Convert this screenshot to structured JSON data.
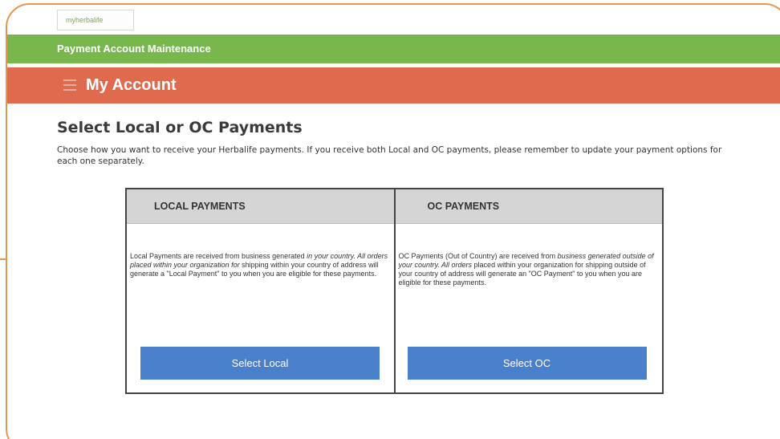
{
  "logo": {
    "text": "myherbalife"
  },
  "green_bar": {
    "title": "Payment Account Maintenance"
  },
  "red_bar": {
    "title": "My Account"
  },
  "main": {
    "title": "Select Local or OC Payments",
    "intro": "Choose how you want to receive your Herbalife payments. If you receive both Local and OC payments, please remember to update your payment options for each one separately."
  },
  "local": {
    "header": "LOCAL PAYMENTS",
    "desc_part1": "Local Payments are received from business generated ",
    "desc_italic": "in your country. All orders placed within your organization for",
    "desc_part2": " shipping within your country of address will generate a \"Local Payment\" to you when you are eligible for these payments.",
    "button": "Select Local"
  },
  "oc": {
    "header": "OC PAYMENTS",
    "desc_part1": "OC Payments (Out of Country) are received from ",
    "desc_italic": "business generated outside of your country. All orders",
    "desc_part2": " placed within your organization for shipping outside of your country of address will generate an \"OC Payment\" to you when you are eligible for these payments.",
    "button": "Select OC"
  },
  "colors": {
    "frame": "#e8954e",
    "green_bar": "#78b74b",
    "red_bar": "#e06a4e",
    "button": "#4a7fcc",
    "header_gray": "#d5d5d5"
  }
}
